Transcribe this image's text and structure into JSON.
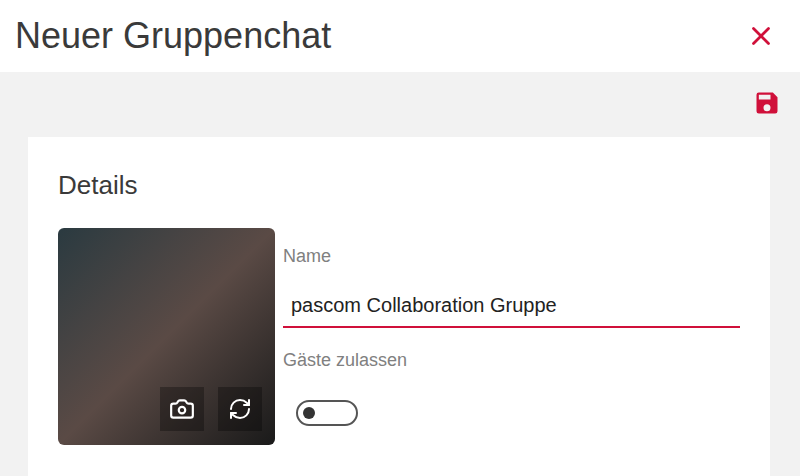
{
  "window": {
    "title": "Neuer Gruppenchat"
  },
  "section": {
    "title": "Details"
  },
  "fields": {
    "name": {
      "label": "Name",
      "value": "pascom Collaboration Gruppe",
      "focused": true
    },
    "guests": {
      "label": "Gäste zulassen",
      "on": false
    }
  }
}
